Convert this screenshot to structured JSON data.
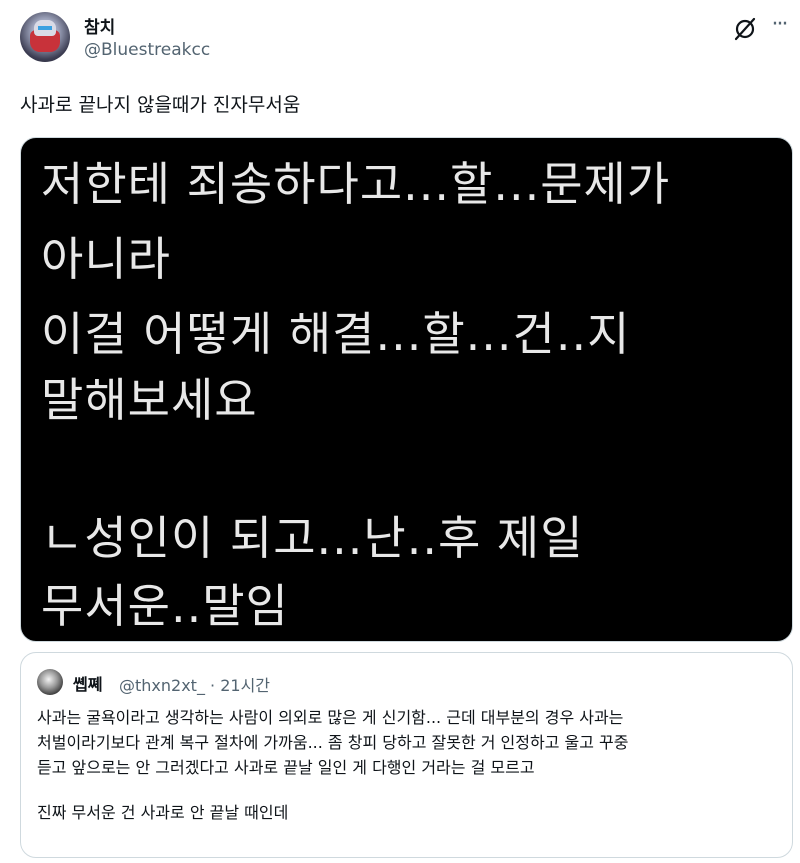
{
  "author": {
    "display_name": "참치",
    "handle": "@Bluestreakcc"
  },
  "icons": {
    "grok": "grok-icon",
    "more": "more-icon"
  },
  "tweet_text": "사과로 끝나지 않을때가 진자무서움",
  "media_lines": [
    "저한테 죄송하다고...할...문제가",
    "아니라",
    "이걸 어떻게 해결...할...건..지",
    "말해보세요",
    "ㄴ성인이 되고...난..후 제일",
    "무서운..말임"
  ],
  "quoted": {
    "display_name": "쏍쪠",
    "handle": "@thxn2xt_ · 21시간",
    "lines": [
      "사과는 굴욕이라고 생각하는 사람이 의외로 많은 게 신기함... 근데 대부분의 경우 사과는",
      "처벌이라기보다 관계 복구 절차에 가까움... 좀 창피 당하고 잘못한 거 인정하고 울고 꾸중",
      "듣고 앞으로는 안 그러겠다고 사과로 끝날 일인 게 다행인 거라는 걸 모르고"
    ],
    "last_line": "진짜 무서운 건 사과로 안 끝날 때인데"
  }
}
